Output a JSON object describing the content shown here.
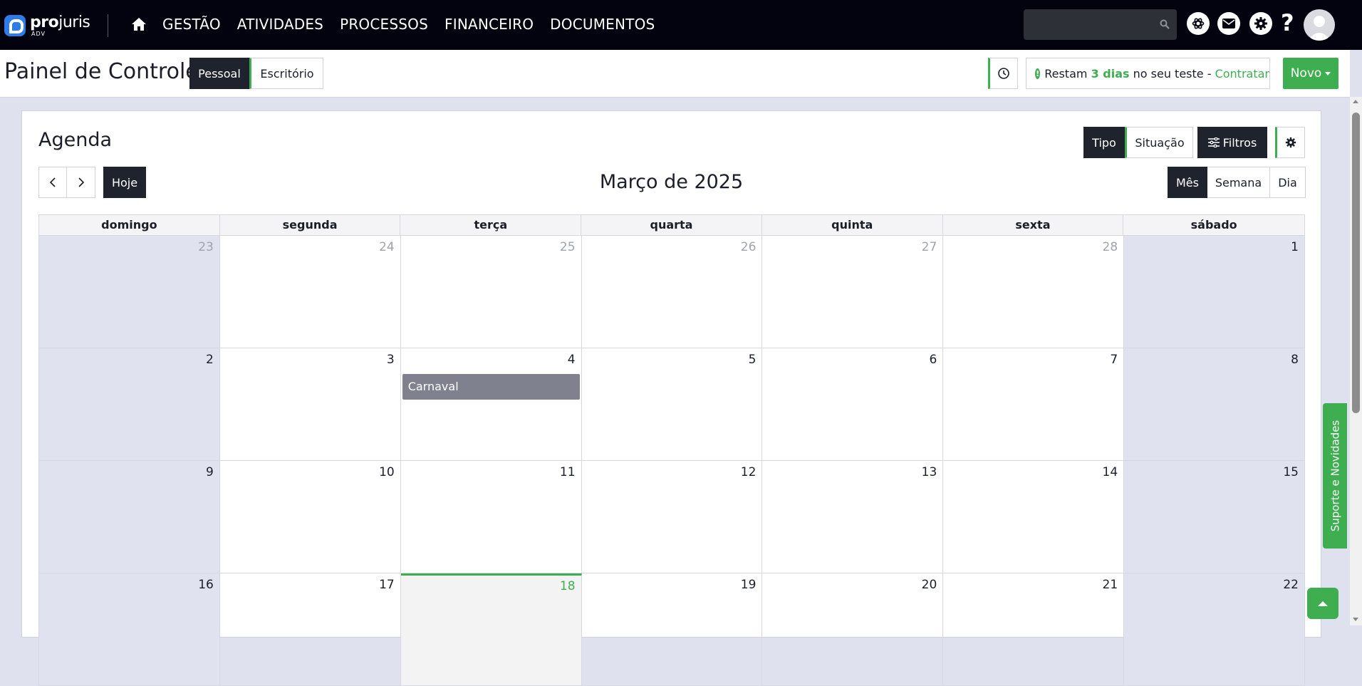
{
  "brand": {
    "name_bold": "pro",
    "name_light": "juris",
    "sub": "ADV"
  },
  "nav": {
    "items": [
      "GESTÃO",
      "ATIVIDADES",
      "PROCESSOS",
      "FINANCEIRO",
      "DOCUMENTOS"
    ],
    "search": {
      "placeholder": "",
      "value": ""
    },
    "help": "?"
  },
  "header": {
    "title": "Painel de Controle",
    "scope_tabs": [
      {
        "label": "Pessoal",
        "active": true
      },
      {
        "label": "Escritório",
        "active": false
      }
    ],
    "trial": {
      "prefix": "Restam",
      "days": "3 dias",
      "middle": "no seu teste -",
      "link": "Contratar"
    },
    "new_button": "Novo"
  },
  "agenda": {
    "title": "Agenda",
    "view_toggle": [
      {
        "label": "Tipo",
        "active": true
      },
      {
        "label": "Situação",
        "active": false
      }
    ],
    "filters_label": "Filtros",
    "today_label": "Hoje",
    "month_title": "Março de 2025",
    "range_toggle": [
      {
        "label": "Mês",
        "active": true
      },
      {
        "label": "Semana",
        "active": false
      },
      {
        "label": "Dia",
        "active": false
      }
    ],
    "weekdays": [
      "domingo",
      "segunda",
      "terça",
      "quarta",
      "quinta",
      "sexta",
      "sábado"
    ],
    "weeks": [
      [
        "23",
        "24",
        "25",
        "26",
        "27",
        "28",
        "1"
      ],
      [
        "2",
        "3",
        "4",
        "5",
        "6",
        "7",
        "8"
      ],
      [
        "9",
        "10",
        "11",
        "12",
        "13",
        "14",
        "15"
      ],
      [
        "16",
        "17",
        "18",
        "19",
        "20",
        "21",
        "22"
      ]
    ],
    "events": [
      {
        "day": "4",
        "title": "Carnaval"
      }
    ],
    "today": "18"
  },
  "support_tab": "Suporte e Novidades",
  "colors": {
    "accent": "#3fae50",
    "navbar": "#02030f",
    "dark_button": "#1f232e",
    "weekend": "#e0e2ef",
    "event": "#7f828e"
  }
}
